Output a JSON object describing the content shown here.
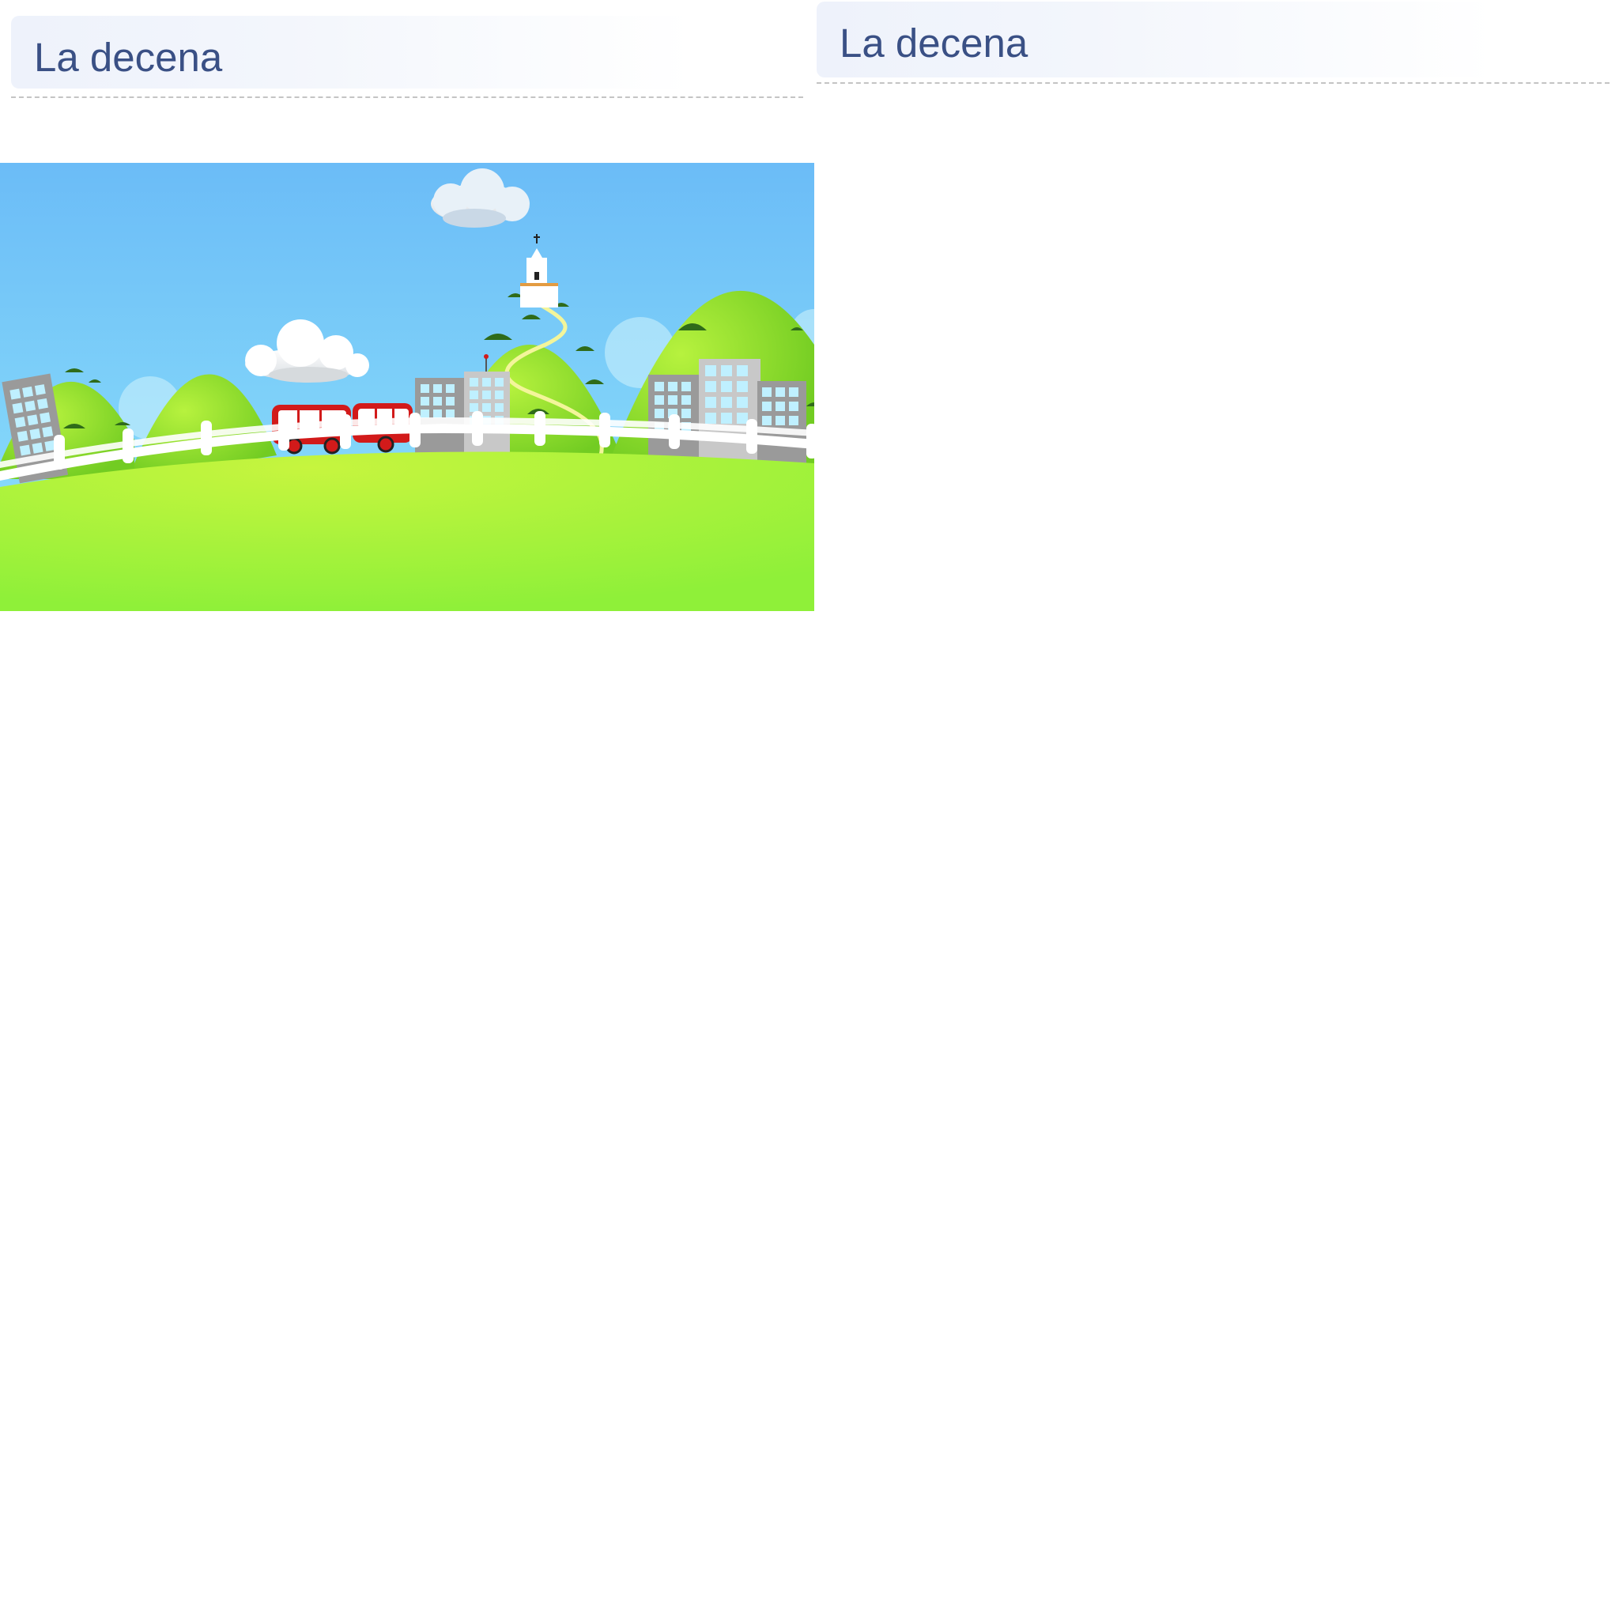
{
  "slides": {
    "left": {
      "title": "La decena"
    },
    "right": {
      "title": "La decena"
    }
  },
  "illustration": {
    "icon": "landscape-illustration",
    "colors": {
      "sky_top": "#6bbcf7",
      "sky_bottom": "#8fe3fb",
      "grass_light": "#c6f53e",
      "grass_dark": "#8ff039",
      "bus_red": "#d21a1a",
      "building_gray": "#9a9a9a",
      "window_blue": "#bff0ff"
    }
  }
}
